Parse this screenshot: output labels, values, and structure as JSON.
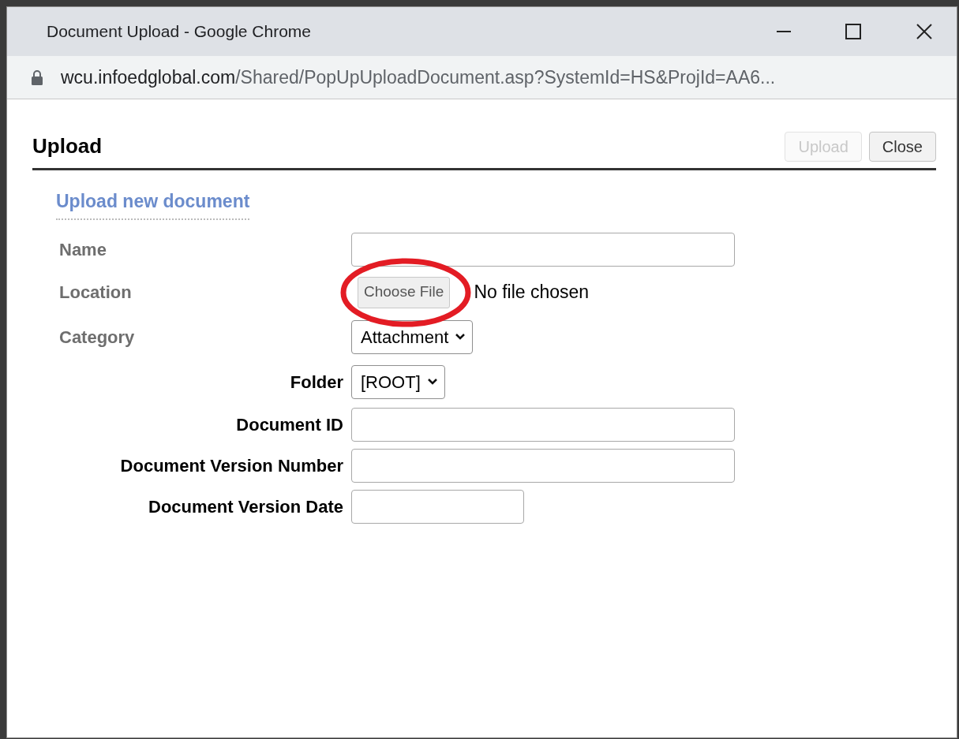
{
  "window": {
    "title": "Document Upload - Google Chrome"
  },
  "address_bar": {
    "domain": "wcu.infoedglobal.com",
    "path": "/Shared/PopUpUploadDocument.asp?SystemId=HS&ProjId=AA6..."
  },
  "header": {
    "title": "Upload",
    "buttons": [
      {
        "label": "Upload",
        "disabled": true
      },
      {
        "label": "Close",
        "disabled": false
      }
    ]
  },
  "section_title": "Upload new document",
  "fields": [
    {
      "kind": "text",
      "label": "Name",
      "muted": true
    },
    {
      "kind": "file",
      "label": "Location",
      "muted": true,
      "button_label": "Choose File",
      "status": "No file chosen",
      "highlighted": true
    },
    {
      "kind": "select",
      "label": "Category",
      "muted": true,
      "value": "Attachment"
    },
    {
      "kind": "select",
      "label": "Folder",
      "muted": false,
      "value": "[ROOT]"
    },
    {
      "kind": "text",
      "label": "Document ID",
      "muted": false
    },
    {
      "kind": "text",
      "label": "Document Version Number",
      "muted": false
    },
    {
      "kind": "date",
      "label": "Document Version Date",
      "muted": false
    }
  ]
}
